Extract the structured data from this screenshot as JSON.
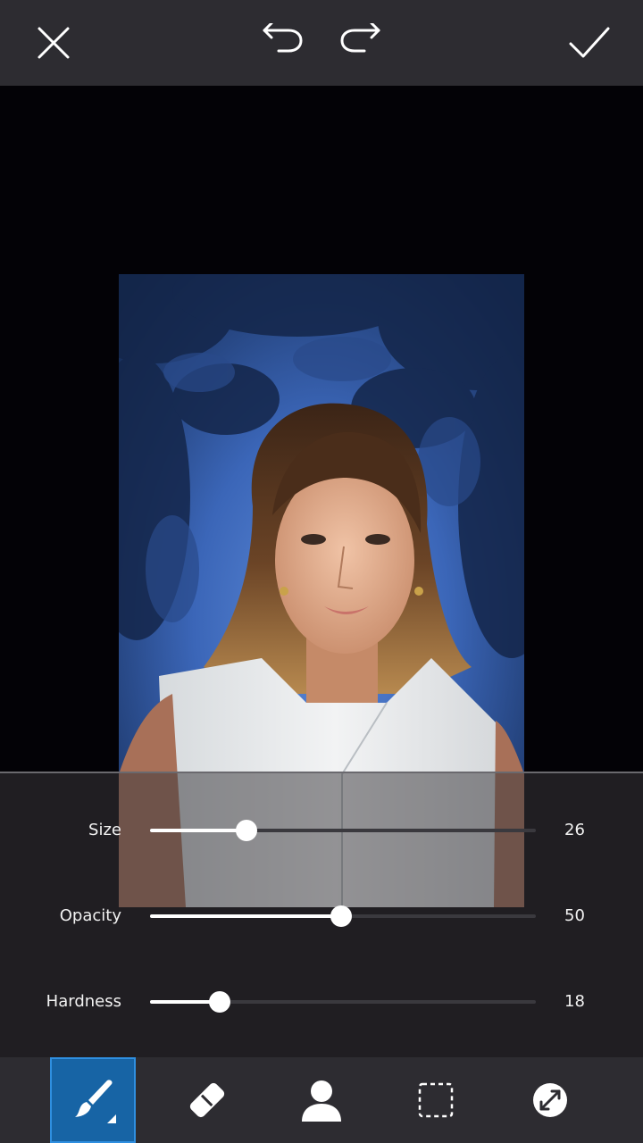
{
  "topbar": {
    "close_icon": "close-icon",
    "undo_icon": "undo-icon",
    "redo_icon": "redo-icon",
    "apply_icon": "checkmark-icon"
  },
  "canvas": {
    "image": "portrait-photo-forest-background"
  },
  "brush_settings": {
    "sliders": [
      {
        "label": "Size",
        "value": "26",
        "fraction": 0.25
      },
      {
        "label": "Opacity",
        "value": "50",
        "fraction": 0.495
      },
      {
        "label": "Hardness",
        "value": "18",
        "fraction": 0.18
      }
    ]
  },
  "tools": [
    {
      "name": "brush",
      "icon": "brush-icon",
      "active": true
    },
    {
      "name": "eraser",
      "icon": "eraser-icon",
      "active": false
    },
    {
      "name": "person",
      "icon": "person-icon",
      "active": false
    },
    {
      "name": "selection",
      "icon": "selection-icon",
      "active": false
    },
    {
      "name": "invert",
      "icon": "invert-icon",
      "active": false
    }
  ],
  "colors": {
    "bar_bg": "#2d2c31",
    "canvas_bg": "#030206",
    "active_tool": "#1764a5",
    "slider_fill": "#ffffff"
  }
}
